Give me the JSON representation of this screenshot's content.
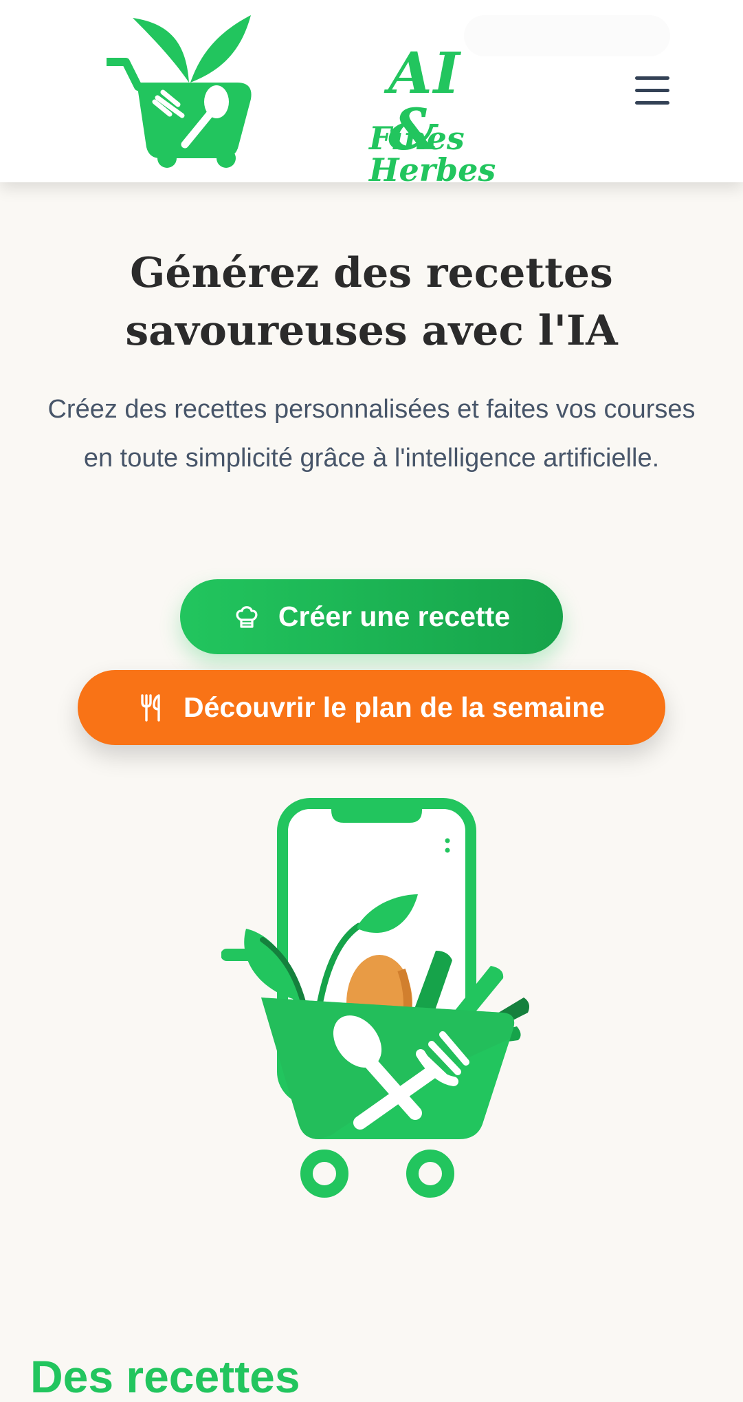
{
  "header": {
    "logo_title": "AI &",
    "logo_subtitle": "Fines Herbes",
    "menu_icon": "hamburger-menu-icon"
  },
  "hero": {
    "title": "Générez des recettes savoureuses avec l'IA",
    "subtitle": "Créez des recettes personnalisées et faites vos courses en toute simplicité grâce à l'intelligence artificielle.",
    "create_button": {
      "label": "Créer une recette",
      "icon": "chef-hat-icon"
    },
    "plan_button": {
      "label": "Découvrir le plan de la semaine",
      "icon": "utensils-icon"
    },
    "illustration": "phone-grocery-cart-illustration"
  },
  "next_section": {
    "heading": "Des recettes"
  },
  "colors": {
    "brand_green": "#22c55e",
    "brand_green_dark": "#16a34a",
    "accent_orange": "#f97316",
    "page_background": "#faf8f4",
    "text_dark": "#2b2b2b",
    "text_muted": "#475569"
  }
}
